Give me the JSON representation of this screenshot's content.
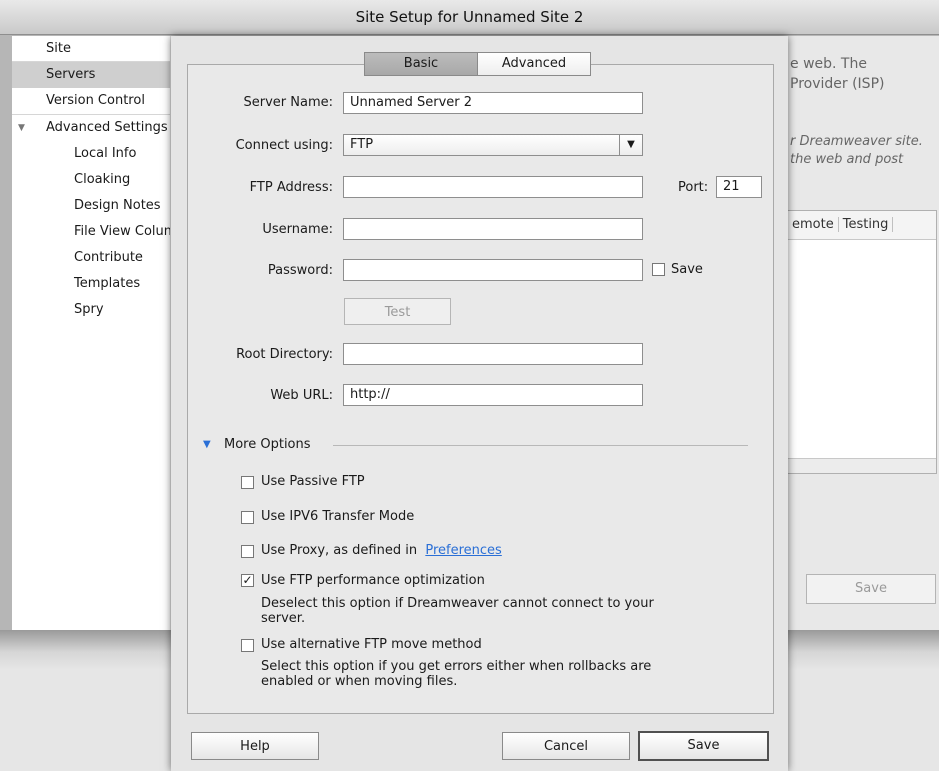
{
  "window": {
    "title": "Site Setup for Unnamed Site 2"
  },
  "sidebar": {
    "items": [
      {
        "label": "Site"
      },
      {
        "label": "Servers"
      },
      {
        "label": "Version Control"
      },
      {
        "label": "Advanced Settings"
      },
      {
        "label": "Local Info"
      },
      {
        "label": "Cloaking"
      },
      {
        "label": "Design Notes"
      },
      {
        "label": "File View Columns"
      },
      {
        "label": "Contribute"
      },
      {
        "label": "Templates"
      },
      {
        "label": "Spry"
      }
    ],
    "selected": "Servers",
    "expand_glyph": "▼"
  },
  "background": {
    "text1": "e web. The",
    "text2": "Provider (ISP)",
    "italic1": "r Dreamweaver site.",
    "italic2": "the web and post",
    "col_remote": "emote",
    "col_testing": "Testing",
    "save_label": "Save"
  },
  "tabs": {
    "basic": "Basic",
    "advanced": "Advanced"
  },
  "form": {
    "server_name_label": "Server Name:",
    "server_name_value": "Unnamed Server 2",
    "connect_label": "Connect using:",
    "connect_value": "FTP",
    "ftp_address_label": "FTP Address:",
    "ftp_address_value": "",
    "port_label": "Port:",
    "port_value": "21",
    "username_label": "Username:",
    "username_value": "",
    "password_label": "Password:",
    "password_value": "",
    "save_password_label": "Save",
    "test_label": "Test",
    "root_label": "Root Directory:",
    "root_value": "",
    "url_label": "Web URL:",
    "url_value": "http://"
  },
  "more_options": {
    "header": "More Options",
    "disclosure_glyph": "▼",
    "passive": {
      "label": "Use Passive FTP",
      "checked": false
    },
    "ipv6": {
      "label": "Use IPV6 Transfer Mode",
      "checked": false
    },
    "proxy": {
      "label": "Use Proxy, as defined in",
      "link": "Preferences",
      "checked": false
    },
    "perf": {
      "label": "Use FTP performance optimization",
      "checked": true,
      "note1": "Deselect this option if Dreamweaver cannot connect to your",
      "note2": "server."
    },
    "altmove": {
      "label": "Use alternative FTP move method",
      "checked": false,
      "note1": "Select this option if you get errors either when rollbacks are",
      "note2": "enabled or when moving files."
    }
  },
  "buttons": {
    "help": "Help",
    "cancel": "Cancel",
    "save": "Save"
  },
  "glyphs": {
    "check": "✓",
    "dropdown": "▼"
  }
}
